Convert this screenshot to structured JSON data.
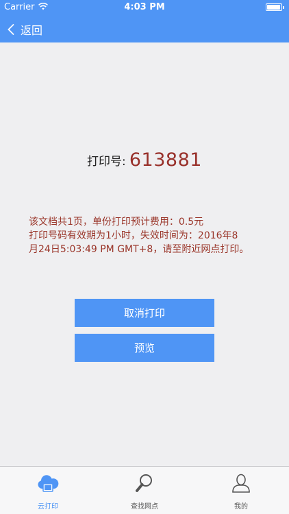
{
  "status_bar": {
    "carrier": "Carrier",
    "time": "4:03 PM"
  },
  "nav": {
    "back_label": "返回"
  },
  "print": {
    "label": "打印号:",
    "number": "613881"
  },
  "info": {
    "line1": "该文档共1页，单份打印预计费用：0.5元",
    "line2": "打印号码有效期为1小时，失效时间为：2016年8",
    "line3": "月24日5:03:49 PM GMT+8，请至附近网点打印。"
  },
  "buttons": {
    "cancel_label": "取消打印",
    "preview_label": "预览"
  },
  "tabbar": {
    "tabs": [
      {
        "label": "云打印",
        "icon": "cloud-print-icon",
        "active": true
      },
      {
        "label": "查找网点",
        "icon": "search-icon",
        "active": false
      },
      {
        "label": "我的",
        "icon": "user-icon",
        "active": false
      }
    ]
  },
  "colors": {
    "primary": "#4f95f5",
    "accent_text": "#98302a",
    "background": "#efeff1"
  }
}
